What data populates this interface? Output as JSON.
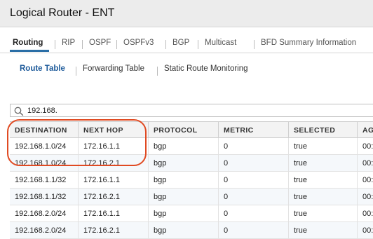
{
  "window": {
    "title": "Logical Router - ENT"
  },
  "tabs": [
    {
      "label": "Routing"
    },
    {
      "label": "RIP"
    },
    {
      "label": "OSPF"
    },
    {
      "label": "OSPFv3"
    },
    {
      "label": "BGP"
    },
    {
      "label": "Multicast"
    },
    {
      "label": "BFD Summary Information"
    }
  ],
  "subtabs": [
    {
      "label": "Route Table"
    },
    {
      "label": "Forwarding Table"
    },
    {
      "label": "Static Route Monitoring"
    }
  ],
  "search": {
    "value": "192.168."
  },
  "table": {
    "columns": [
      "DESTINATION",
      "NEXT HOP",
      "PROTOCOL",
      "METRIC",
      "SELECTED",
      "AG"
    ],
    "rows": [
      [
        "192.168.1.0/24",
        "172.16.1.1",
        "bgp",
        "0",
        "true",
        "00:"
      ],
      [
        "192.168.1.0/24",
        "172.16.2.1",
        "bgp",
        "0",
        "true",
        "00:"
      ],
      [
        "192.168.1.1/32",
        "172.16.1.1",
        "bgp",
        "0",
        "true",
        "00:"
      ],
      [
        "192.168.1.1/32",
        "172.16.2.1",
        "bgp",
        "0",
        "true",
        "00:"
      ],
      [
        "192.168.2.0/24",
        "172.16.1.1",
        "bgp",
        "0",
        "true",
        "00:"
      ],
      [
        "192.168.2.0/24",
        "172.16.2.1",
        "bgp",
        "0",
        "true",
        "00:"
      ]
    ]
  },
  "colors": {
    "accent": "#2a6ea6",
    "highlight": "#e04a22",
    "link": "#1d5a9a"
  },
  "icons": {
    "search": "search-icon"
  }
}
